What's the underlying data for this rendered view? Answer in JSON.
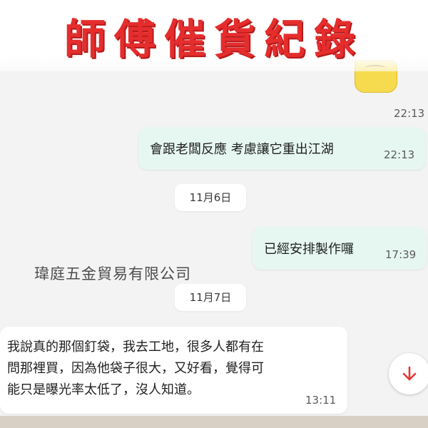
{
  "banner": {
    "title": "師傅催貨紀錄"
  },
  "messages": {
    "sticker_time": "22:13",
    "m1": {
      "text": "會跟老闆反應 考慮讓它重出江湖",
      "time": "22:13"
    },
    "date1": "11月6日",
    "m2": {
      "text": "已經安排製作囉",
      "time": "17:39"
    },
    "watermark": "瑋庭五金貿易有限公司",
    "date2": "11月7日",
    "m3": {
      "lines": [
        "我說真的那個釘袋，我去工地，很多人都有在",
        "問那裡買，因為他袋子很大，又好看，覺得可",
        "能只是曝光率太低了，沒人知道。"
      ],
      "time": "13:11"
    }
  },
  "icons": {
    "scroll_down": "arrow-down-icon",
    "sticker": "sticker-emoji"
  },
  "colors": {
    "title": "#e52d2d",
    "outgoing_bubble": "#e6f7f1",
    "incoming_bubble": "#ffffff",
    "fab_arrow": "#e53935"
  }
}
